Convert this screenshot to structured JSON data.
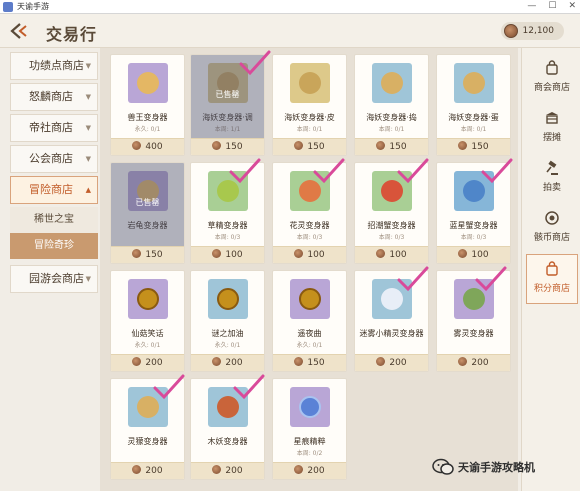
{
  "window": {
    "title": "天谕手游"
  },
  "header": {
    "title": "交易行",
    "currency_amount": "12,100"
  },
  "left_nav": {
    "items": [
      "功绩点商店",
      "怒麟商店",
      "帝社商店",
      "公会商店",
      "冒险商店",
      "园游会商店"
    ],
    "active": "冒险商店",
    "sub_items": [
      "稀世之宝",
      "冒险奇珍"
    ],
    "active_sub": "冒险奇珍"
  },
  "items": [
    {
      "name": "兽王变身器",
      "limit": "永久: 0/1",
      "price": "400",
      "sold": false,
      "sold_label": ""
    },
    {
      "name": "海妖变身器·调",
      "limit": "本周: 1/1",
      "price": "150",
      "sold": true,
      "sold_label": "已售罄"
    },
    {
      "name": "海妖变身器·皮",
      "limit": "本周: 0/1",
      "price": "150",
      "sold": false,
      "sold_label": ""
    },
    {
      "name": "海妖变身器·捣",
      "limit": "本周: 0/1",
      "price": "150",
      "sold": false,
      "sold_label": ""
    },
    {
      "name": "海妖变身器·蛋",
      "limit": "本周: 0/1",
      "price": "150",
      "sold": false,
      "sold_label": ""
    },
    {
      "name": "岩龟变身器",
      "limit": "",
      "price": "150",
      "sold": true,
      "sold_label": "已售罄"
    },
    {
      "name": "草精变身器",
      "limit": "本周: 0/3",
      "price": "100",
      "sold": false,
      "sold_label": ""
    },
    {
      "name": "花灵变身器",
      "limit": "本周: 0/3",
      "price": "100",
      "sold": false,
      "sold_label": ""
    },
    {
      "name": "招潮蟹变身器",
      "limit": "本周: 0/3",
      "price": "100",
      "sold": false,
      "sold_label": ""
    },
    {
      "name": "蓝星蟹变身器",
      "limit": "本周: 0/3",
      "price": "100",
      "sold": false,
      "sold_label": ""
    },
    {
      "name": "仙菇笑话",
      "limit": "永久: 0/1",
      "price": "200",
      "sold": false,
      "sold_label": ""
    },
    {
      "name": "谜之加油",
      "limit": "永久: 0/1",
      "price": "200",
      "sold": false,
      "sold_label": ""
    },
    {
      "name": "遥夜曲",
      "limit": "永久: 0/1",
      "price": "150",
      "sold": false,
      "sold_label": ""
    },
    {
      "name": "迷雾小精灵变身器",
      "limit": "",
      "price": "200",
      "sold": false,
      "sold_label": ""
    },
    {
      "name": "雾灵变身器",
      "limit": "",
      "price": "200",
      "sold": false,
      "sold_label": ""
    },
    {
      "name": "灵獴变身器",
      "limit": "",
      "price": "200",
      "sold": false,
      "sold_label": ""
    },
    {
      "name": "木妖变身器",
      "limit": "",
      "price": "200",
      "sold": false,
      "sold_label": ""
    },
    {
      "name": "星痕精粹",
      "limit": "本周: 0/2",
      "price": "200",
      "sold": false,
      "sold_label": ""
    }
  ],
  "right_nav": {
    "items": [
      "商会商店",
      "摆摊",
      "拍卖",
      "骸币商店",
      "积分商店"
    ],
    "icons": [
      "shop-bag-icon",
      "stall-icon",
      "gavel-icon",
      "bone-coin-icon",
      "points-shop-icon"
    ],
    "active": "积分商店"
  },
  "watermark": {
    "text": "天谕手游攻略机"
  },
  "colors": {
    "accent": "#c25d2a",
    "check_mark": "#d94a9a",
    "sold_overlay": "#50546e"
  }
}
